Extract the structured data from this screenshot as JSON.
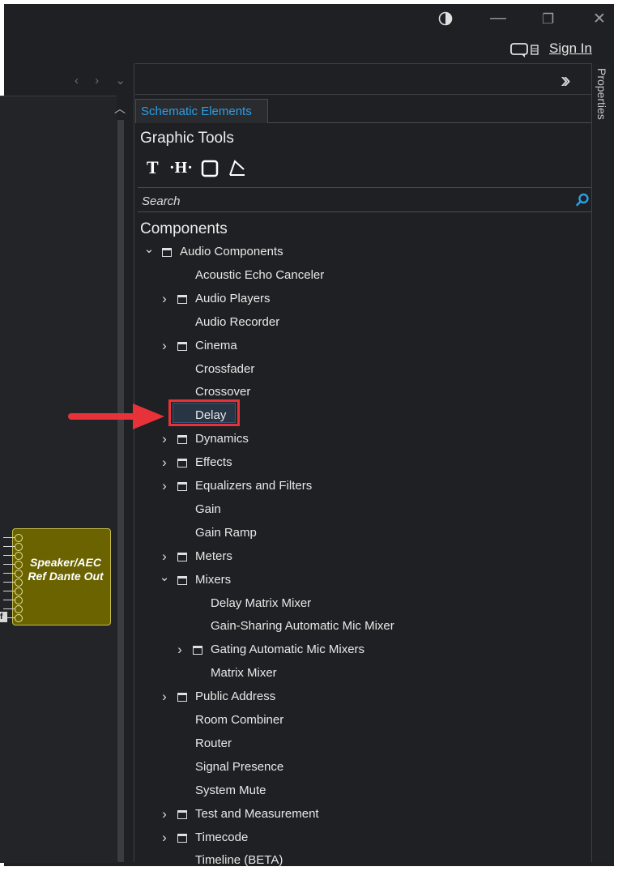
{
  "titlebar": {
    "theme_icon": "contrast-icon",
    "minimize": "—",
    "restore": "❐",
    "close": "✕",
    "sign_in": "Sign In"
  },
  "schematic": {
    "nav_arrows": "‹ › ⌄",
    "block_label": "Speaker/AEC Ref Dante Out",
    "ref_tag": "f",
    "accent": "#6a6300"
  },
  "panel": {
    "properties_label": "Properties",
    "tab_label": "Schematic Elements",
    "graphic_tools_title": "Graphic Tools",
    "tools": [
      "T",
      "·H·",
      "▢",
      "◿"
    ],
    "search_placeholder": "Search",
    "components_title": "Components",
    "tree": [
      {
        "label": "Audio Components",
        "folder": true,
        "expanded": true,
        "level": 0
      },
      {
        "label": "Acoustic Echo Canceler",
        "folder": false,
        "level": 1
      },
      {
        "label": "Audio Players",
        "folder": true,
        "expanded": false,
        "level": 1
      },
      {
        "label": "Audio Recorder",
        "folder": false,
        "level": 1
      },
      {
        "label": "Cinema",
        "folder": true,
        "expanded": false,
        "level": 1
      },
      {
        "label": "Crossfader",
        "folder": false,
        "level": 1
      },
      {
        "label": "Crossover",
        "folder": false,
        "level": 1
      },
      {
        "label": "Delay",
        "folder": false,
        "level": 1,
        "selected": true
      },
      {
        "label": "Dynamics",
        "folder": true,
        "expanded": false,
        "level": 1
      },
      {
        "label": "Effects",
        "folder": true,
        "expanded": false,
        "level": 1
      },
      {
        "label": "Equalizers and Filters",
        "folder": true,
        "expanded": false,
        "level": 1
      },
      {
        "label": "Gain",
        "folder": false,
        "level": 1
      },
      {
        "label": "Gain Ramp",
        "folder": false,
        "level": 1
      },
      {
        "label": "Meters",
        "folder": true,
        "expanded": false,
        "level": 1
      },
      {
        "label": "Mixers",
        "folder": true,
        "expanded": true,
        "level": 1
      },
      {
        "label": "Delay Matrix Mixer",
        "folder": false,
        "level": 2
      },
      {
        "label": "Gain-Sharing Automatic Mic Mixer",
        "folder": false,
        "level": 2
      },
      {
        "label": "Gating Automatic Mic Mixers",
        "folder": true,
        "expanded": false,
        "level": 2
      },
      {
        "label": "Matrix Mixer",
        "folder": false,
        "level": 2
      },
      {
        "label": "Public Address",
        "folder": true,
        "expanded": false,
        "level": 1
      },
      {
        "label": "Room Combiner",
        "folder": false,
        "level": 1
      },
      {
        "label": "Router",
        "folder": false,
        "level": 1
      },
      {
        "label": "Signal Presence",
        "folder": false,
        "level": 1
      },
      {
        "label": "System Mute",
        "folder": false,
        "level": 1
      },
      {
        "label": "Test and Measurement",
        "folder": true,
        "expanded": false,
        "level": 1
      },
      {
        "label": "Timecode",
        "folder": true,
        "expanded": false,
        "level": 1
      },
      {
        "label": "Timeline (BETA)",
        "folder": false,
        "level": 1
      }
    ],
    "accent_color": "#2a9fe6",
    "highlight_color": "#e8323a"
  }
}
